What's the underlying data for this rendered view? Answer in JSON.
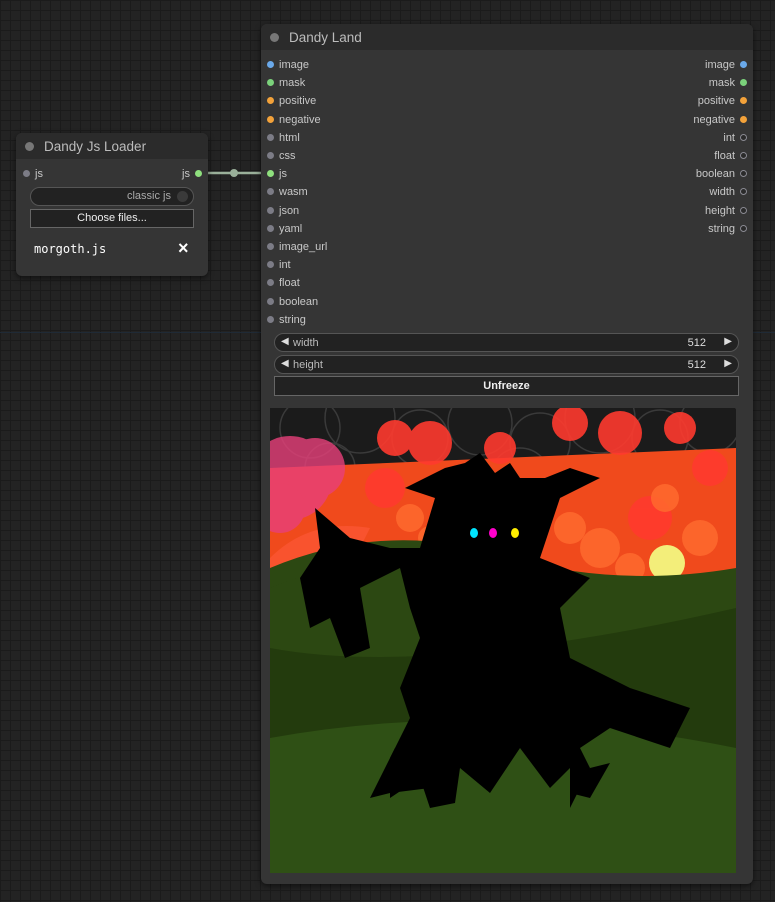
{
  "loader": {
    "title": "Dandy Js Loader",
    "input_label": "js",
    "output_label": "js",
    "toggle_label": "classic js",
    "choose_button": "Choose files...",
    "file_name": "morgoth.js",
    "remove_icon": "×"
  },
  "land": {
    "title": "Dandy Land",
    "inputs": [
      {
        "label": "image",
        "color": "#6aa9ea"
      },
      {
        "label": "mask",
        "color": "#7bd27b"
      },
      {
        "label": "positive",
        "color": "#f3a23a"
      },
      {
        "label": "negative",
        "color": "#f3a23a"
      },
      {
        "label": "html",
        "color": "#7c7c86"
      },
      {
        "label": "css",
        "color": "#7c7c86"
      },
      {
        "label": "js",
        "color": "#8fe07e"
      },
      {
        "label": "wasm",
        "color": "#7c7c86"
      },
      {
        "label": "json",
        "color": "#7c7c86"
      },
      {
        "label": "yaml",
        "color": "#7c7c86"
      },
      {
        "label": "image_url",
        "color": "#7c7c86"
      },
      {
        "label": "int",
        "color": "#7c7c86"
      },
      {
        "label": "float",
        "color": "#7c7c86"
      },
      {
        "label": "boolean",
        "color": "#7c7c86"
      },
      {
        "label": "string",
        "color": "#7c7c86"
      }
    ],
    "outputs": [
      {
        "label": "image",
        "color": "#6aa9ea"
      },
      {
        "label": "mask",
        "color": "#7bd27b"
      },
      {
        "label": "positive",
        "color": "#f3a23a"
      },
      {
        "label": "negative",
        "color": "#f3a23a"
      },
      {
        "label": "int",
        "color": "#7c7c86"
      },
      {
        "label": "float",
        "color": "#7c7c86"
      },
      {
        "label": "boolean",
        "color": "#7c7c86"
      },
      {
        "label": "width",
        "color": "#7c7c86"
      },
      {
        "label": "height",
        "color": "#7c7c86"
      },
      {
        "label": "string",
        "color": "#7c7c86"
      }
    ],
    "width_widget": {
      "label": "width",
      "value": "512"
    },
    "height_widget": {
      "label": "height",
      "value": "512"
    },
    "unfreeze_button": "Unfreeze"
  },
  "canvas_colors": {
    "sky": "#f04a1c",
    "hill_dark": "#233b0d",
    "hill_mid": "#2c4812",
    "hill_light": "#2f5015",
    "sun": "#f3ee7a",
    "figure": "#000000",
    "eye_left": "#00e5ff",
    "eye_mid": "#ff00cc",
    "eye_right": "#ffee00"
  }
}
